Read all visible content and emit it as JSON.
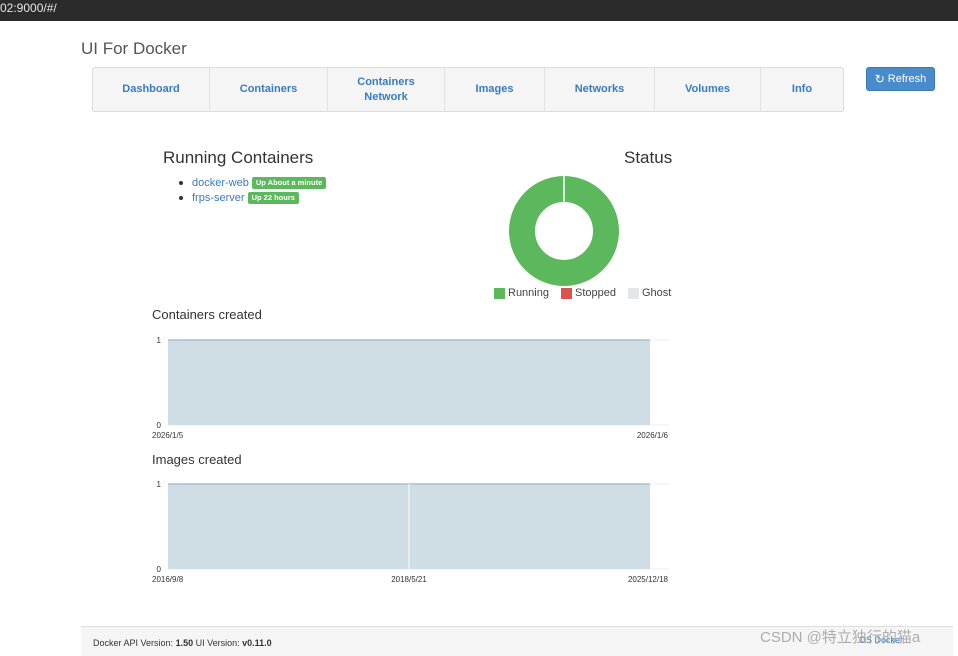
{
  "browser": {
    "url_fragment": "02:9000/#/"
  },
  "app": {
    "title": "UI For Docker"
  },
  "nav": {
    "items": [
      {
        "label": "Dashboard"
      },
      {
        "label": "Containers"
      },
      {
        "label_line1": "Containers",
        "label_line2": "Network"
      },
      {
        "label": "Images"
      },
      {
        "label": "Networks"
      },
      {
        "label": "Volumes"
      },
      {
        "label": "Info"
      }
    ]
  },
  "refresh": {
    "label": "Refresh",
    "icon": "refresh-icon"
  },
  "running": {
    "title": "Running Containers",
    "containers": [
      {
        "name": "docker-web",
        "status": "Up About a minute"
      },
      {
        "name": "frps-server",
        "status": "Up 22 hours"
      }
    ]
  },
  "status": {
    "title": "Status",
    "legend": [
      {
        "label": "Running",
        "color": "#5cb85c"
      },
      {
        "label": "Stopped",
        "color": "#d9534f"
      },
      {
        "label": "Ghost",
        "color": "#e2e8ea"
      }
    ]
  },
  "chart_data": [
    {
      "type": "pie",
      "title": "Status",
      "categories": [
        "Running",
        "Stopped",
        "Ghost"
      ],
      "values": [
        2,
        0,
        0
      ],
      "colors": [
        "#5cb85c",
        "#d9534f",
        "#e2e8ea"
      ],
      "donut": true
    },
    {
      "type": "area",
      "title": "Containers created",
      "x": [
        "2026/1/5",
        "2026/1/6"
      ],
      "y": [
        1,
        1
      ],
      "ylim": [
        0,
        1
      ],
      "yticks": [
        "0",
        "1"
      ],
      "xticks": [
        "2026/1/5",
        "2026/1/6"
      ],
      "color": "#cfdde5"
    },
    {
      "type": "area",
      "title": "Images created",
      "x": [
        "2016/9/8",
        "2018/5/21",
        "2025/12/18"
      ],
      "y": [
        1,
        1,
        1
      ],
      "ylim": [
        0,
        1
      ],
      "yticks": [
        "0",
        "1"
      ],
      "xticks": [
        "2016/9/8",
        "2018/5/21",
        "2025/12/18"
      ],
      "color": "#cfdde5"
    }
  ],
  "footer": {
    "api_label": "Docker API Version:",
    "api_version": "1.50",
    "ui_label": "UI Version:",
    "ui_version": "v0.11.0",
    "link": "OS Docker"
  },
  "watermark": "CSDN @特立独行的猫a"
}
